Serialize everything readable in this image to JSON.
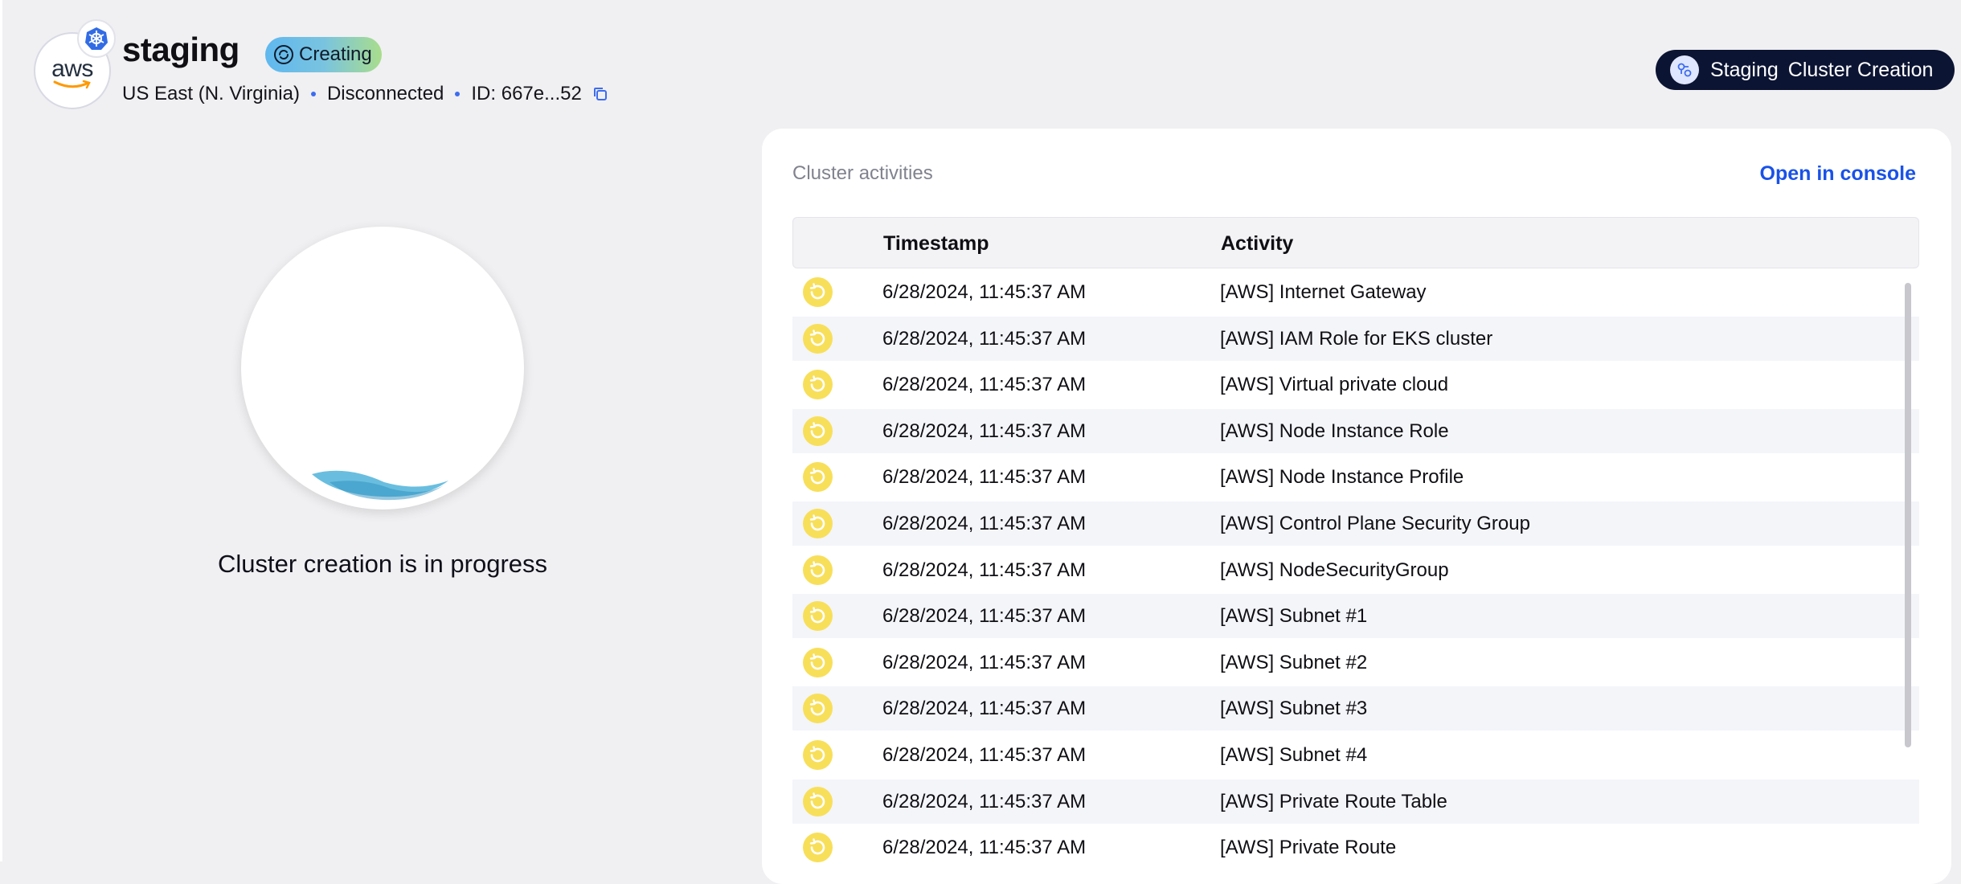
{
  "header": {
    "provider_logo": "aws",
    "cluster_name": "staging",
    "status": "Creating",
    "region": "US East (N. Virginia)",
    "connection": "Disconnected",
    "id_label": "ID: 667e...52",
    "environment_pill": {
      "env": "Staging",
      "label": "Cluster Creation"
    }
  },
  "progress": {
    "label": "Cluster creation is in progress",
    "level": 0.05
  },
  "activities": {
    "title": "Cluster activities",
    "open_console": "Open in console",
    "columns": [
      "",
      "Timestamp",
      "Activity"
    ],
    "rows": [
      {
        "status_icon": "in-progress-icon",
        "timestamp": "6/28/2024, 11:45:37 AM",
        "activity": "[AWS] Internet Gateway"
      },
      {
        "status_icon": "in-progress-icon",
        "timestamp": "6/28/2024, 11:45:37 AM",
        "activity": "[AWS] IAM Role for EKS cluster"
      },
      {
        "status_icon": "in-progress-icon",
        "timestamp": "6/28/2024, 11:45:37 AM",
        "activity": "[AWS] Virtual private cloud"
      },
      {
        "status_icon": "in-progress-icon",
        "timestamp": "6/28/2024, 11:45:37 AM",
        "activity": "[AWS] Node Instance Role"
      },
      {
        "status_icon": "in-progress-icon",
        "timestamp": "6/28/2024, 11:45:37 AM",
        "activity": "[AWS] Node Instance Profile"
      },
      {
        "status_icon": "in-progress-icon",
        "timestamp": "6/28/2024, 11:45:37 AM",
        "activity": "[AWS] Control Plane Security Group"
      },
      {
        "status_icon": "in-progress-icon",
        "timestamp": "6/28/2024, 11:45:37 AM",
        "activity": "[AWS] NodeSecurityGroup"
      },
      {
        "status_icon": "in-progress-icon",
        "timestamp": "6/28/2024, 11:45:37 AM",
        "activity": "[AWS] Subnet #1"
      },
      {
        "status_icon": "in-progress-icon",
        "timestamp": "6/28/2024, 11:45:37 AM",
        "activity": "[AWS] Subnet #2"
      },
      {
        "status_icon": "in-progress-icon",
        "timestamp": "6/28/2024, 11:45:37 AM",
        "activity": "[AWS] Subnet #3"
      },
      {
        "status_icon": "in-progress-icon",
        "timestamp": "6/28/2024, 11:45:37 AM",
        "activity": "[AWS] Subnet #4"
      },
      {
        "status_icon": "in-progress-icon",
        "timestamp": "6/28/2024, 11:45:37 AM",
        "activity": "[AWS] Private Route Table"
      },
      {
        "status_icon": "in-progress-icon",
        "timestamp": "6/28/2024, 11:45:37 AM",
        "activity": "[AWS] Private Route"
      }
    ]
  },
  "colors": {
    "accent_blue": "#1a52e8",
    "pending_yellow": "#f8df5a",
    "env_pill_bg": "#0c1433",
    "wave_blue": "#4fb3d9"
  }
}
